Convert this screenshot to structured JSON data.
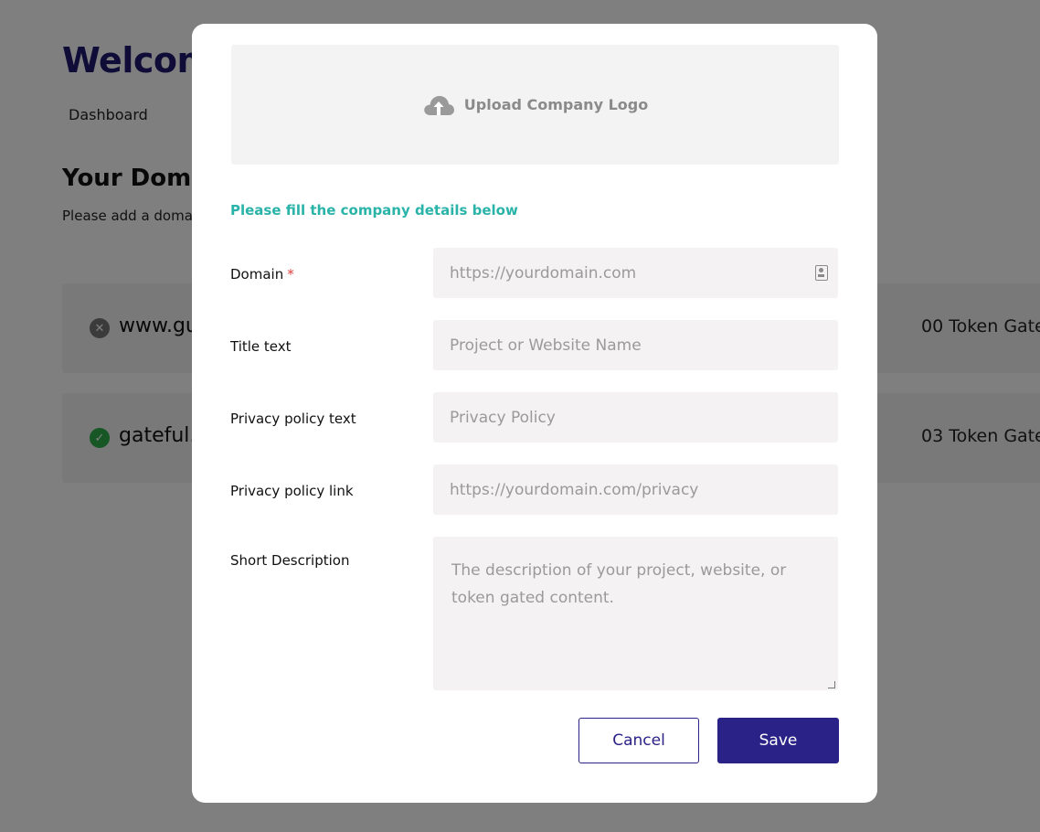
{
  "background": {
    "welcome_title": "Welcome",
    "nav_dashboard": "Dashboard",
    "domains_title": "Your Doma",
    "domains_subtitle": "Please add a doma",
    "rows": [
      {
        "name": "www.gu",
        "count": "00 Token Gate",
        "status": "inactive"
      },
      {
        "name": "gateful.i",
        "count": "03 Token Gate",
        "status": "active"
      }
    ]
  },
  "modal": {
    "upload_label": "Upload Company Logo",
    "upload_icon": "cloud-upload-icon",
    "section_heading": "Please fill the company details below",
    "fields": {
      "domain": {
        "label": "Domain",
        "required_mark": "*",
        "placeholder": "https://yourdomain.com",
        "value": ""
      },
      "title": {
        "label": "Title text",
        "placeholder": "Project or Website Name",
        "value": ""
      },
      "privacy_text": {
        "label": "Privacy policy text",
        "placeholder": "Privacy Policy",
        "value": ""
      },
      "privacy_link": {
        "label": "Privacy policy link",
        "placeholder": "https://yourdomain.com/privacy",
        "value": ""
      },
      "description": {
        "label": "Short Description",
        "placeholder": "The description of your project, website, or token gated content.",
        "value": ""
      }
    },
    "cancel_label": "Cancel",
    "save_label": "Save"
  },
  "colors": {
    "primary": "#2a2287",
    "accent_teal": "#2ab3a8",
    "required_red": "#e03a3a",
    "status_ok": "#2fae4d"
  }
}
